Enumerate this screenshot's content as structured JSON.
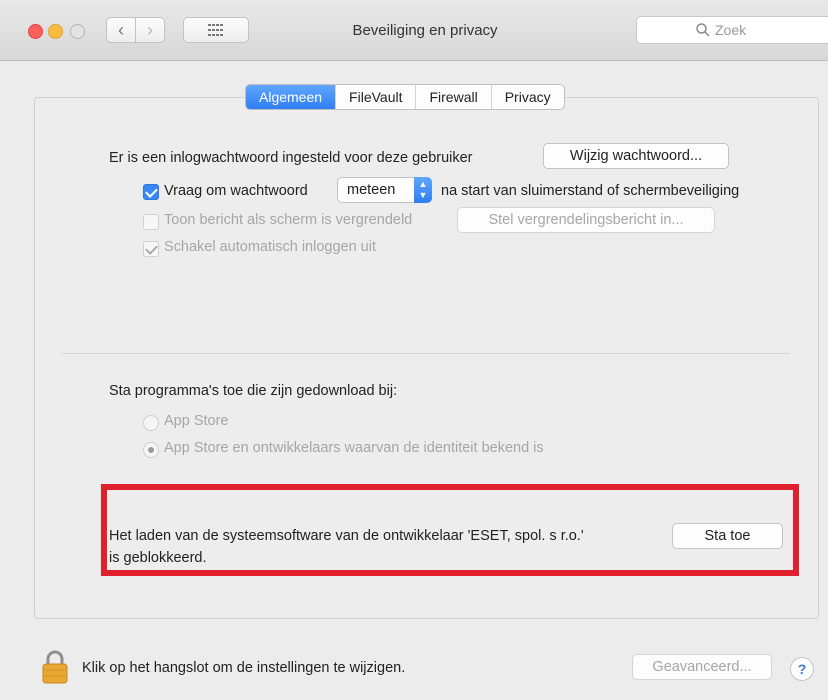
{
  "window": {
    "title": "Beveiliging en privacy",
    "search_placeholder": "Zoek"
  },
  "tabs": [
    {
      "label": "Algemeen",
      "active": true
    },
    {
      "label": "FileVault",
      "active": false
    },
    {
      "label": "Firewall",
      "active": false
    },
    {
      "label": "Privacy",
      "active": false
    }
  ],
  "password": {
    "status_text": "Er is een inlogwachtwoord ingesteld voor deze gebruiker",
    "change_button": "Wijzig wachtwoord..."
  },
  "options": {
    "require_password": {
      "label": "Vraag om wachtwoord",
      "checked": true
    },
    "delay_value": "meteen",
    "delay_suffix": "na start van sluimerstand of schermbeveiliging",
    "show_message": {
      "label": "Toon bericht als scherm is vergrendeld",
      "checked": false
    },
    "lock_message_button": "Stel vergrendelingsbericht in...",
    "disable_autologin": {
      "label": "Schakel automatisch inloggen uit",
      "checked": true
    }
  },
  "downloads": {
    "heading": "Sta programma's toe die zijn gedownload bij:",
    "option_appstore": "App Store",
    "option_identified": "App Store en ontwikkelaars waarvan de identiteit bekend is",
    "selected": "App Store en ontwikkelaars waarvan de identiteit bekend is"
  },
  "system_extension": {
    "line1": "Het laden van de systeemsoftware van de ontwikkelaar 'ESET, spol. s r.o.'",
    "line2": "is geblokkeerd.",
    "allow_button": "Sta toe"
  },
  "footer": {
    "lock_text": "Klik op het hangslot om de instellingen te wijzigen.",
    "advanced_button": "Geavanceerd...",
    "help_label": "?"
  },
  "colors": {
    "accent": "#2f7ef3",
    "highlight_border": "#e0202c"
  }
}
